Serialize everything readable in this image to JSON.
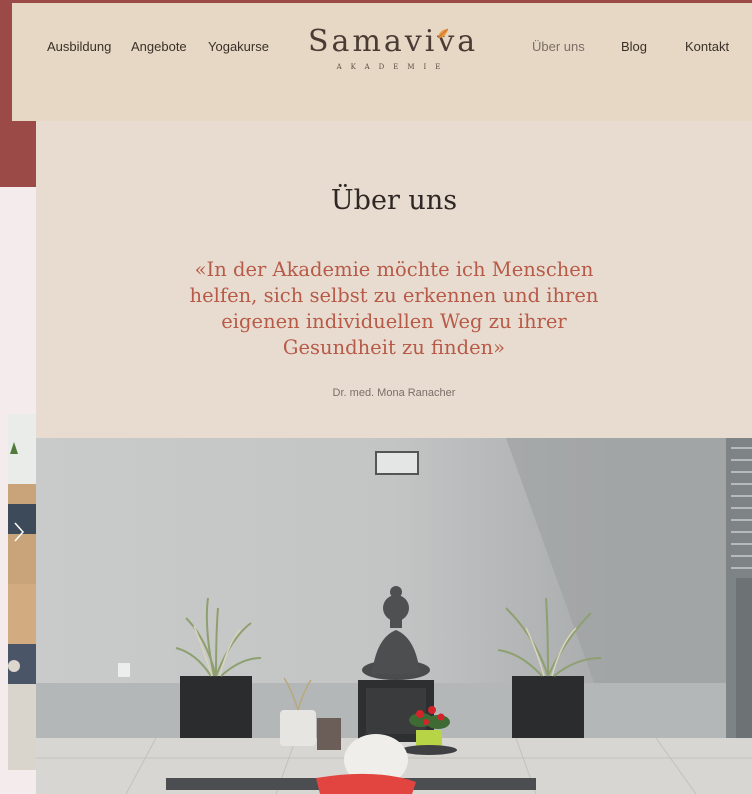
{
  "nav": {
    "left": [
      "Ausbildung",
      "Angebote",
      "Yogakurse"
    ],
    "right": [
      "Über uns",
      "Blog",
      "Kontakt"
    ],
    "active": "Über uns"
  },
  "logo": {
    "name": "Samaviva",
    "subtitle": "AKADEMIE"
  },
  "intro": {
    "title": "Über uns",
    "quote": "«In der Akademie möchte ich Menschen helfen, sich selbst zu erkennen und ihren eigenen individuellen Weg zu ihrer Gesundheit zu finden»",
    "author": "Dr. med. Mona Ranacher"
  },
  "slider": {
    "next_icon": "chevron-right-icon"
  },
  "colors": {
    "header_bg": "#e6d8c4",
    "intro_bg": "#e8dcd0",
    "accent": "#b75a48",
    "frame": "#9b4a48"
  }
}
